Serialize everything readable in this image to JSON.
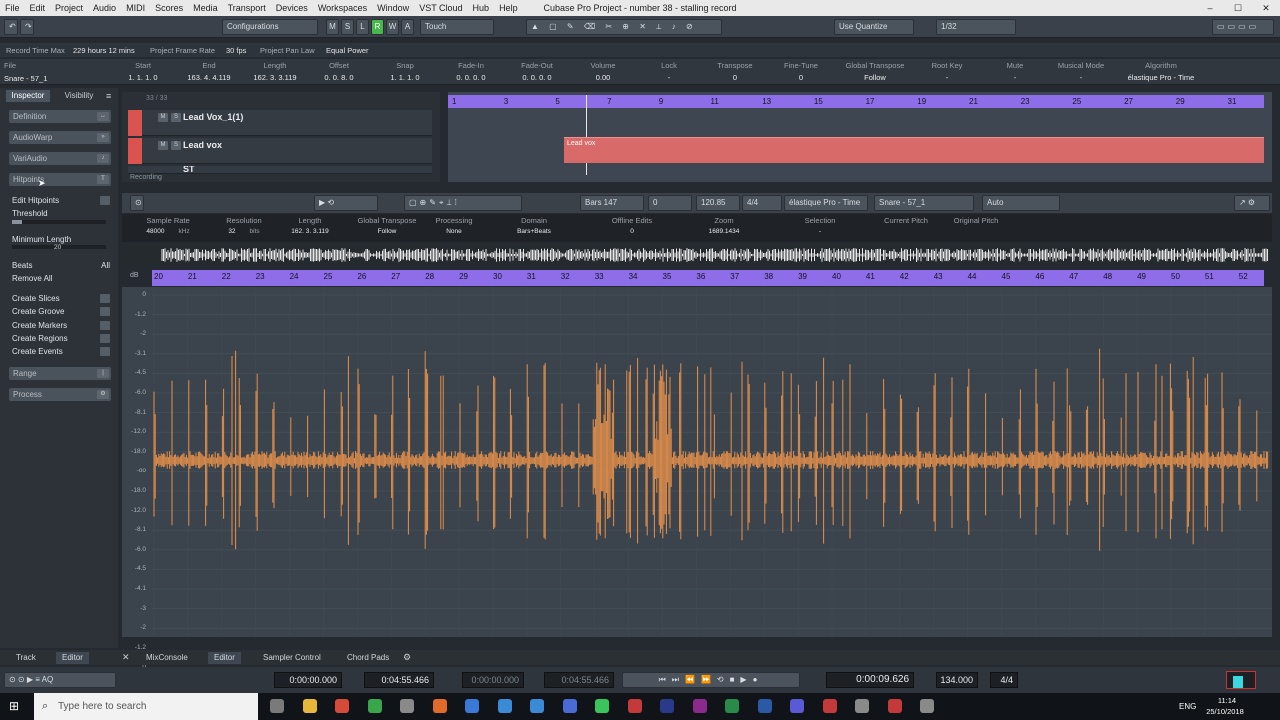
{
  "menu": [
    "File",
    "Edit",
    "Project",
    "Audio",
    "MIDI",
    "Scores",
    "Media",
    "Transport",
    "Devices",
    "Workspaces",
    "Window",
    "VST Cloud",
    "Hub",
    "Help"
  ],
  "window_title": "Cubase Pro Project - number 38 - stalling record",
  "toolbar": {
    "configurations": "Configurations",
    "modes": [
      "M",
      "S",
      "L",
      "R",
      "W",
      "A"
    ],
    "touch": "Touch",
    "quantize": "Use Quantize",
    "grid": "1/32"
  },
  "status": {
    "record_time_label": "Record Time Max",
    "record_time": "229 hours 12 mins",
    "frame_rate_label": "Project Frame Rate",
    "frame_rate": "30 fps",
    "pan_law_label": "Project Pan Law",
    "pan_law": "Equal Power"
  },
  "infoline": {
    "file_label": "File",
    "file": "Snare - 57_1",
    "columns": [
      [
        "Start",
        "1. 1. 1.  0"
      ],
      [
        "End",
        "163. 4. 4.119"
      ],
      [
        "Length",
        "162. 3. 3.119"
      ],
      [
        "Offset",
        "0. 0. 8.  0"
      ],
      [
        "Snap",
        "1. 1. 1.  0"
      ],
      [
        "Fade-In",
        "0. 0. 0.  0"
      ],
      [
        "Fade-Out",
        "0. 0. 0.  0"
      ],
      [
        "Volume",
        "0.00"
      ],
      [
        "Lock",
        "-"
      ],
      [
        "Transpose",
        "0"
      ],
      [
        "Fine-Tune",
        "0"
      ],
      [
        "Global Transpose",
        "Follow"
      ],
      [
        "Root Key",
        "-"
      ],
      [
        "Mute",
        "-"
      ],
      [
        "Musical Mode",
        "-"
      ],
      [
        "Algorithm",
        "élastique Pro - Time"
      ]
    ]
  },
  "inspector": {
    "tab1": "Inspector",
    "tab2": "Visibility",
    "sections": [
      "Definition",
      "AudioWarp",
      "VariAudio",
      "Hitpoints"
    ],
    "edit_hitpoints": "Edit Hitpoints",
    "threshold": "Threshold",
    "min_length": "Minimum Length",
    "min_length_val": "20",
    "beats": "Beats",
    "beats_val": "All",
    "remove_all": "Remove All",
    "actions": [
      "Create Slices",
      "Create Groove",
      "Create Markers",
      "Create Regions",
      "Create Events"
    ],
    "range": "Range",
    "process": "Process"
  },
  "tracklist": {
    "count": "33 / 33",
    "tracks": [
      "Lead Vox_1(1)",
      "Lead vox",
      "ST"
    ],
    "recording": "Recording"
  },
  "arrange": {
    "ruler": [
      "1",
      "3",
      "5",
      "7",
      "9",
      "11",
      "13",
      "15",
      "17",
      "19",
      "21",
      "23",
      "25",
      "27",
      "29",
      "31"
    ],
    "event": "Lead vox"
  },
  "editor": {
    "bars": "147",
    "beats": "0",
    "tempo": "120.85",
    "signature": "4/4",
    "algorithm": "élastique Pro - Time",
    "event": "Snare - 57_1",
    "auto": "Auto",
    "info": [
      [
        "Sample Rate",
        "48000",
        "kHz"
      ],
      [
        "Resolution",
        "32",
        "bits"
      ],
      [
        "Length",
        "162. 3. 3.119",
        ""
      ],
      [
        "Global Transpose",
        "Follow",
        ""
      ],
      [
        "Processing",
        "None",
        ""
      ],
      [
        "Domain",
        "Bars+Beats",
        ""
      ],
      [
        "Offline Edits",
        "0",
        ""
      ],
      [
        "Zoom",
        "1689.1434",
        ""
      ],
      [
        "Selection",
        "-",
        ""
      ],
      [
        "Current Pitch",
        "",
        ""
      ],
      [
        "Original Pitch",
        "",
        ""
      ]
    ],
    "ruler": [
      "20",
      "21",
      "22",
      "23",
      "24",
      "25",
      "26",
      "27",
      "28",
      "29",
      "30",
      "31",
      "32",
      "33",
      "34",
      "35",
      "36",
      "37",
      "38",
      "39",
      "40",
      "41",
      "42",
      "43",
      "44",
      "45",
      "46",
      "47",
      "48",
      "49",
      "50",
      "51",
      "52"
    ],
    "db_unit": "dB",
    "db": [
      "0",
      "-1.2",
      "-2",
      "-3.1",
      "-4.5",
      "-6.0",
      "-8.1",
      "-12.0",
      "-18.0",
      "-oo",
      "-18.0",
      "-12.0",
      "-8.1",
      "-6.0",
      "-4.5",
      "-4.1",
      "-3",
      "-2",
      "-1.2",
      "0"
    ]
  },
  "bottom": {
    "left_tabs": [
      "Track",
      "Editor"
    ],
    "tabs": [
      "MixConsole",
      "Editor",
      "Sampler Control",
      "Chord Pads"
    ]
  },
  "transport": {
    "t1": "0:00:00.000",
    "t2": "0:04:55.466",
    "t3": "0:00:00.000",
    "t4": "0:04:55.466",
    "pos": "0:00:09.626",
    "tempo": "134.000",
    "sig": "4/4"
  },
  "taskbar": {
    "search": "Type here to search",
    "lang": "ENG",
    "time": "11:14",
    "date": "25/10/2018"
  }
}
